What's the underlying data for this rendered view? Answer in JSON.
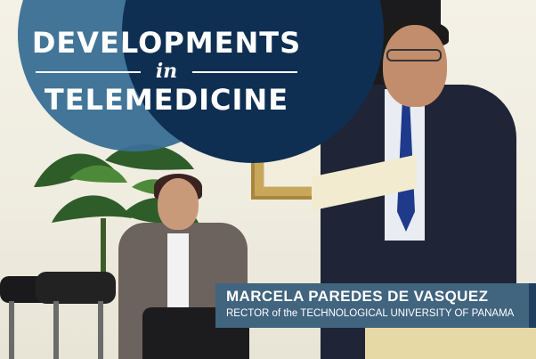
{
  "header": {
    "title_top": "DEVELOPMENTS",
    "title_mid": "in",
    "title_bottom": "TELEMEDICINE"
  },
  "caption": {
    "name": "MARCELA PAREDES DE VASQUEZ",
    "role": "RECTOR of the TECHNOLOGICAL UNIVERSITY OF PANAMA"
  },
  "colors": {
    "circle_light": "#3a6f95",
    "circle_dark": "#0f2f52",
    "banner": "#41647f"
  }
}
